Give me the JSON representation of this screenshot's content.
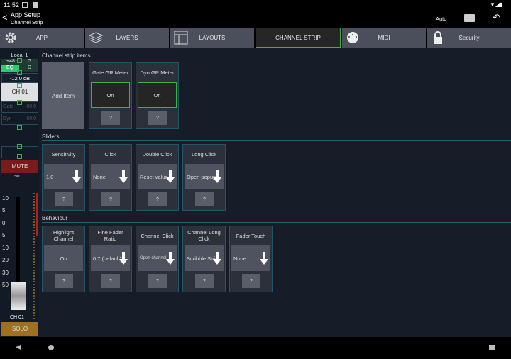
{
  "status": {
    "time": "11:52"
  },
  "header": {
    "title": "App Setup",
    "subtitle": "Channel Strip",
    "auto_label": "Auto"
  },
  "tabs": [
    {
      "label": "APP",
      "icon": "gear-icon"
    },
    {
      "label": "LAYERS",
      "icon": "layers-icon"
    },
    {
      "label": "LAYOUTS",
      "icon": "layout-icon"
    },
    {
      "label": "CHANNEL STRIP",
      "selected": true
    },
    {
      "label": "MIDI",
      "icon": "midi-icon"
    },
    {
      "label": "Security",
      "icon": "lock-icon"
    }
  ],
  "strip": {
    "name": "Local 1",
    "phantom": "+48",
    "g": "G",
    "eq": "EQ",
    "d": "D",
    "gain": "-12.0 dB",
    "channel": "CH 01",
    "gate_label": "Gate",
    "gate_value": "-80.0",
    "dyn_label": "Dyn",
    "dyn_value": "-60.0",
    "mute": "MUTE",
    "level": "-∞",
    "scale": [
      "10",
      "5",
      "0",
      "5",
      "10",
      "20",
      "30",
      "50"
    ],
    "fader_label": "CH 01",
    "solo": "SOLO"
  },
  "sections": {
    "items": {
      "title": "Channel strip items",
      "add": "Add Item",
      "cards": [
        {
          "title": "Gate GR Meter",
          "value": "On",
          "help": "?"
        },
        {
          "title": "Dyn GR Meter",
          "value": "On",
          "help": "?"
        }
      ]
    },
    "sliders": {
      "title": "Sliders",
      "cards": [
        {
          "title": "Sensitivity",
          "value": "1.0",
          "help": "?"
        },
        {
          "title": "Click",
          "value": "None",
          "help": "?"
        },
        {
          "title": "Double Click",
          "value": "Reset value",
          "help": "?"
        },
        {
          "title": "Long Click",
          "value": "Open popup",
          "help": "?"
        }
      ]
    },
    "behaviour": {
      "title": "Behaviour",
      "cards": [
        {
          "title": "Highlight Channel",
          "value": "On",
          "help": "?"
        },
        {
          "title": "Fine Fader Ratio",
          "value": "0.7 (default)",
          "help": "?"
        },
        {
          "title": "Channel Click",
          "value": "Open channel",
          "help": "?"
        },
        {
          "title": "Channel Long Click",
          "value": "Scribble Strip",
          "help": "?"
        },
        {
          "title": "Fader Touch",
          "value": "None",
          "help": "?"
        }
      ]
    }
  },
  "colors": {
    "accent": "#3cb043",
    "mute": "#7a1a1a",
    "solo": "#a07020",
    "tab": "#4b4f5c"
  }
}
